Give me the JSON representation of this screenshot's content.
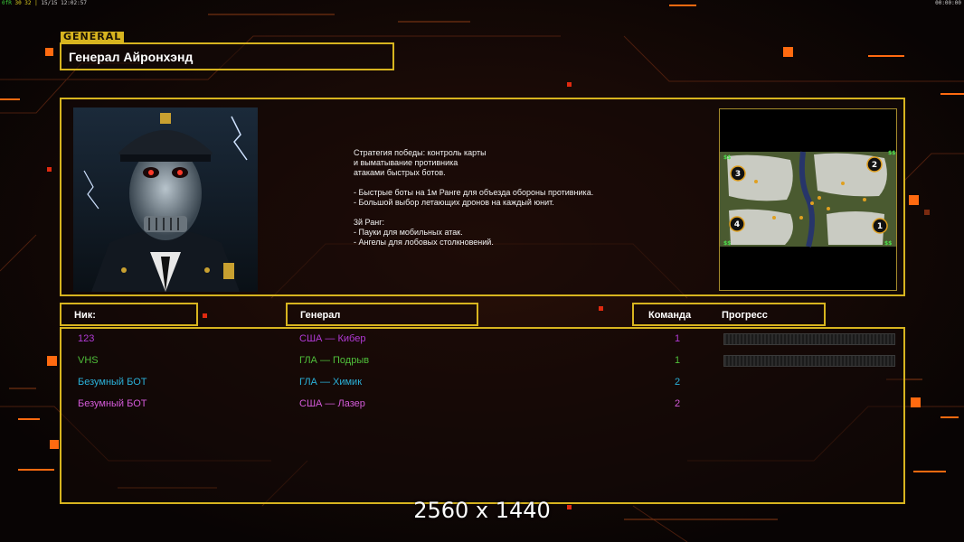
{
  "hud": {
    "left_prefix": "0fR",
    "left_stats": "30 32 |",
    "left_extra": "15/15",
    "clock_left": "12:02:57",
    "clock_right": "00:00:00"
  },
  "general_tag": "GENERAL",
  "general_name": "Генерал Айронхэнд",
  "description": "Стратегия победы: контроль карты\nи выматывание противника\nатаками быстрых ботов.\n\n- Быстрые боты на 1м Ранге для объезда обороны противника.\n- Большой выбор летающих дронов на каждый юнит.\n\n3й Ранг:\n- Пауки для мобильных атак.\n- Ангелы для лобовых столкновений.",
  "minimap": {
    "spawns": [
      "1",
      "2",
      "3",
      "4"
    ],
    "money_marker": "$$"
  },
  "headers": {
    "nick": "Ник:",
    "general": "Генерал",
    "team": "Команда",
    "progress": "Прогресс"
  },
  "players": [
    {
      "nick": "123",
      "general": "США — Кибер",
      "team": "1",
      "color": "#b23ad6",
      "has_progress": true
    },
    {
      "nick": "VHS",
      "general": "ГЛА — Подрыв",
      "team": "1",
      "color": "#4fbf3a",
      "has_progress": true
    },
    {
      "nick": "Безумный БОТ",
      "general": "ГЛА — Химик",
      "team": "2",
      "color": "#2ab0d8",
      "has_progress": false
    },
    {
      "nick": "Безумный БОТ",
      "general": "США — Лазер",
      "team": "2",
      "color": "#d35ad8",
      "has_progress": false
    }
  ],
  "resolution": "2560 x 1440",
  "colors": {
    "frame": "#d7b41f",
    "accent_orange": "#ff6a10"
  }
}
